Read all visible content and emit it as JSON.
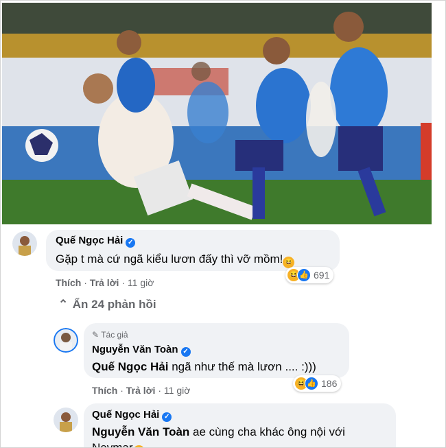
{
  "photo": {
    "alt_icon": "football-match-photo"
  },
  "comments": [
    {
      "author": "Quế Ngọc Hải",
      "text": "Gặp t mà cứ ngã kiểu lươn đấy thì vỡ mồm!",
      "text_emoji": "🤣",
      "like_label": "Thích",
      "reply_label": "Trả lời",
      "time": "11 giờ",
      "reaction_count": "691"
    }
  ],
  "replies_toggle": {
    "label": "Ẩn 24 phản hồi"
  },
  "replies": [
    {
      "author_tag": "Tác giả",
      "author": "Nguyễn Văn Toàn",
      "mention": "Quế Ngọc Hải",
      "text": " ngã như thế mà lươn .... :)))",
      "like_label": "Thích",
      "reply_label": "Trả lời",
      "time": "11 giờ",
      "reaction_count": "186"
    },
    {
      "author": "Quế Ngọc Hải",
      "mention": "Nguyễn Văn Toàn",
      "text": " ae cùng cha khác ông nội với",
      "text_line2": "Neymar",
      "text_emoji": "🤣"
    }
  ],
  "separators": {
    "dot": "·"
  },
  "colors": {
    "verified": "#1877f2",
    "bubble": "#f0f2f5",
    "meta": "#65676b"
  }
}
